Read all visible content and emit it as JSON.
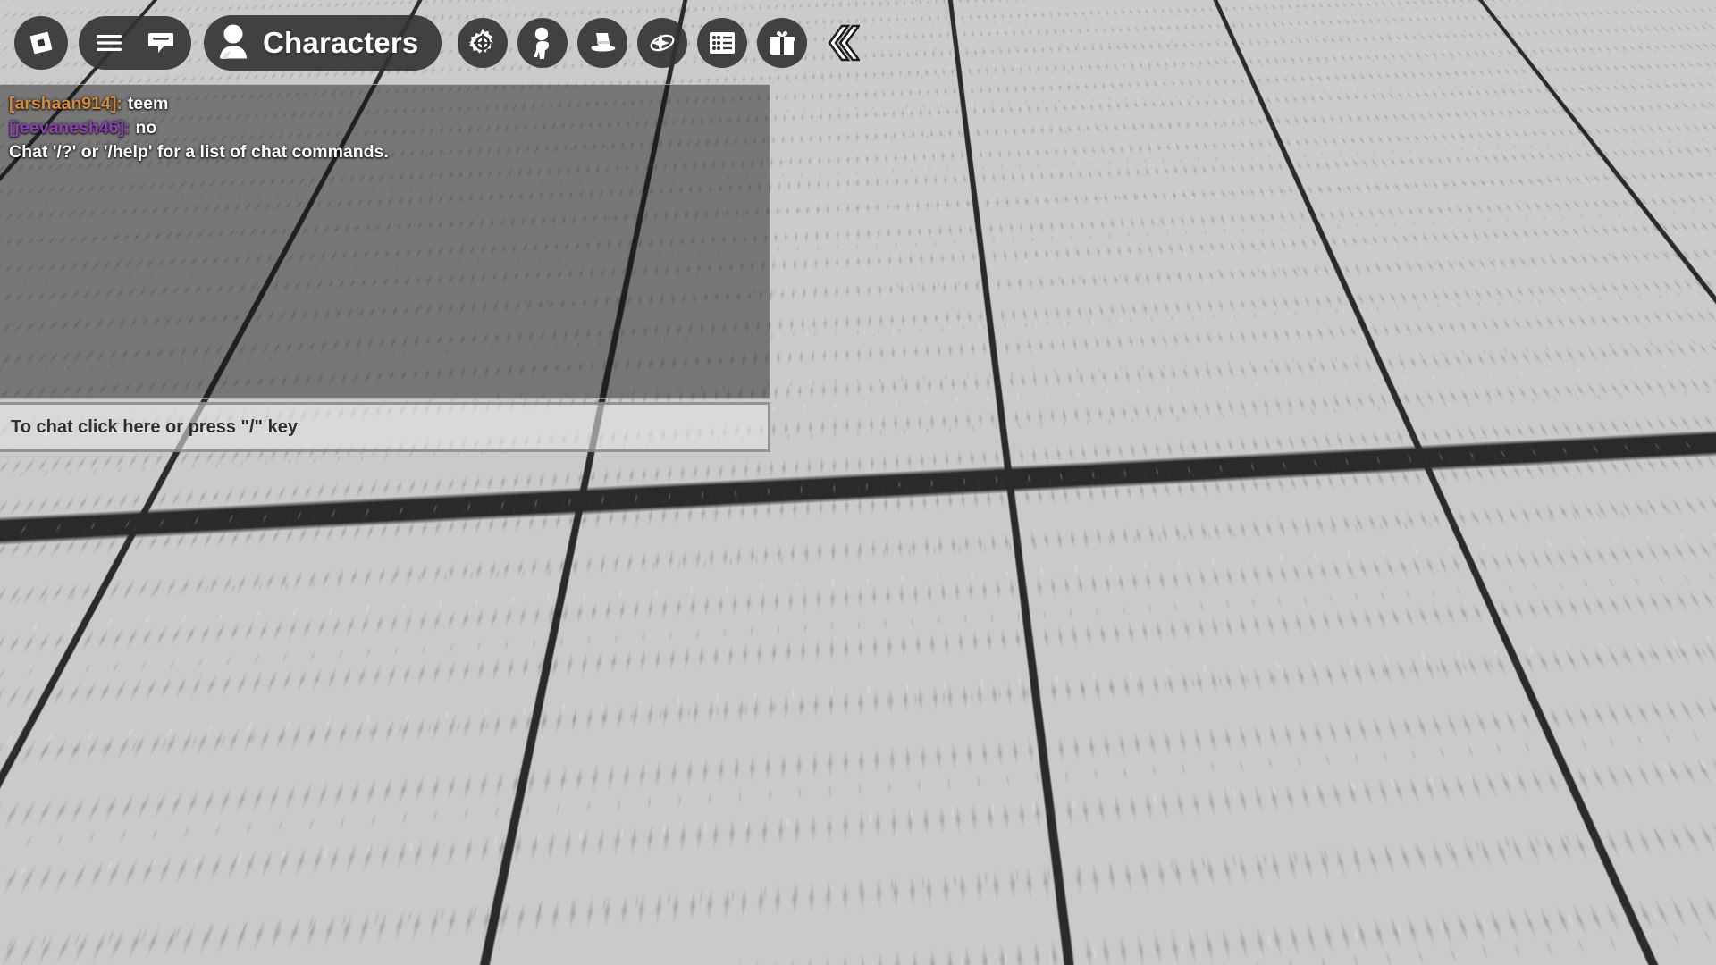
{
  "app": {
    "name": "Roblox",
    "view": "in-game"
  },
  "topbar": {
    "roblox_logo": {
      "icon": "roblox-logo-icon",
      "label": "Roblox"
    },
    "menu_group": [
      {
        "icon": "hamburger-menu-icon",
        "label": "Menu"
      },
      {
        "icon": "chat-bubble-icon",
        "label": "Chat"
      }
    ],
    "characters_button": {
      "icon": "person-icon",
      "label": "Characters"
    },
    "icon_buttons": [
      {
        "icon": "gear-settings-icon",
        "label": "Settings"
      },
      {
        "icon": "avatar-body-icon",
        "label": "Avatar"
      },
      {
        "icon": "top-hat-icon",
        "label": "Hats"
      },
      {
        "icon": "sparkle-orbit-icon",
        "label": "Effects"
      },
      {
        "icon": "leaderboard-list-icon",
        "label": "Leaderboard"
      },
      {
        "icon": "gift-box-icon",
        "label": "Gifts"
      }
    ],
    "collapse_button": {
      "icon": "double-chevron-left-icon",
      "label": "Collapse"
    }
  },
  "chat": {
    "messages": [
      {
        "user": "[arshaan914]:",
        "user_color": "#d58a3c",
        "text": "teem"
      },
      {
        "user": "[jeevanesh46]:",
        "user_color": "#8f3fb5",
        "text": "no"
      },
      {
        "user": "",
        "user_color": "#ffffff",
        "text": "Chat '/?' or '/help' for a list of chat commands."
      }
    ],
    "input_placeholder": "To chat click here or press \"/\" key"
  },
  "world": {
    "avatar": {
      "label": "player-avatar",
      "hair_color": "#4e3f2c",
      "shirt_color": "#9c3f8e",
      "skin_color": "#a89191"
    },
    "floor": {
      "tile_color": "#c6c6c6",
      "grout_color": "#2a2a2a"
    }
  }
}
